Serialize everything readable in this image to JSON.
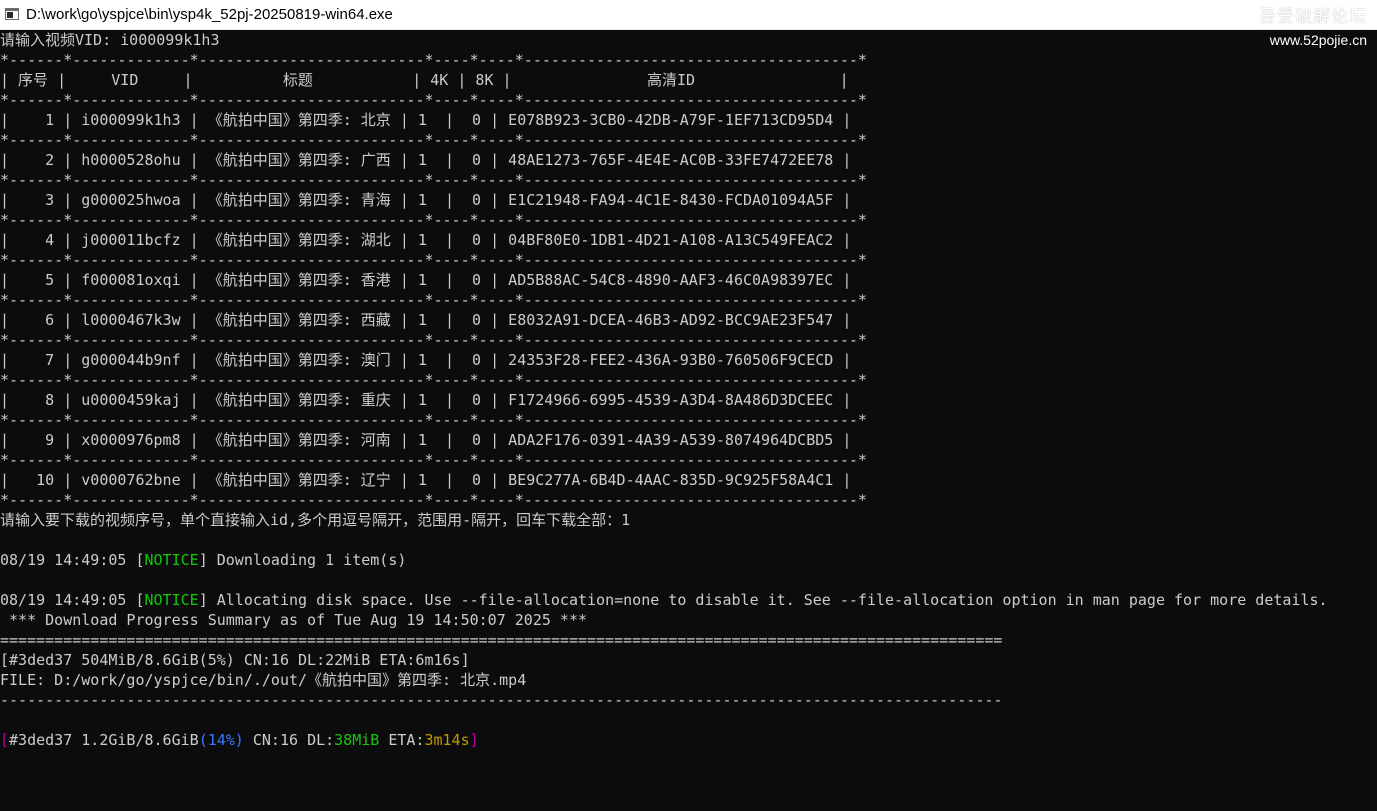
{
  "window": {
    "title": "D:\\work\\go\\yspjce\\bin\\ysp4k_52pj-20250819-win64.exe",
    "watermark_cn": "吾爱破解论坛",
    "watermark_url": "www.52pojie.cn"
  },
  "prompt_vid": "请输入视频VID: i000099k1h3",
  "table": {
    "border_top": "*------*-------------*-------------------------*----*----*-------------------------------------*",
    "headers": [
      "序号",
      "VID",
      "标题",
      "4K",
      "8K",
      "高清ID"
    ],
    "rows": [
      {
        "no": "1",
        "vid": "i000099k1h3",
        "title": "《航拍中国》第四季: 北京",
        "k4": "1",
        "k8": "0",
        "hdid": "E078B923-3CB0-42DB-A79F-1EF713CD95D4"
      },
      {
        "no": "2",
        "vid": "h0000528ohu",
        "title": "《航拍中国》第四季: 广西",
        "k4": "1",
        "k8": "0",
        "hdid": "48AE1273-765F-4E4E-AC0B-33FE7472EE78"
      },
      {
        "no": "3",
        "vid": "g000025hwoa",
        "title": "《航拍中国》第四季: 青海",
        "k4": "1",
        "k8": "0",
        "hdid": "E1C21948-FA94-4C1E-8430-FCDA01094A5F"
      },
      {
        "no": "4",
        "vid": "j000011bcfz",
        "title": "《航拍中国》第四季: 湖北",
        "k4": "1",
        "k8": "0",
        "hdid": "04BF80E0-1DB1-4D21-A108-A13C549FEAC2"
      },
      {
        "no": "5",
        "vid": "f000081oxqi",
        "title": "《航拍中国》第四季: 香港",
        "k4": "1",
        "k8": "0",
        "hdid": "AD5B88AC-54C8-4890-AAF3-46C0A98397EC"
      },
      {
        "no": "6",
        "vid": "l0000467k3w",
        "title": "《航拍中国》第四季: 西藏",
        "k4": "1",
        "k8": "0",
        "hdid": "E8032A91-DCEA-46B3-AD92-BCC9AE23F547"
      },
      {
        "no": "7",
        "vid": "g000044b9nf",
        "title": "《航拍中国》第四季: 澳门",
        "k4": "1",
        "k8": "0",
        "hdid": "24353F28-FEE2-436A-93B0-760506F9CECD"
      },
      {
        "no": "8",
        "vid": "u0000459kaj",
        "title": "《航拍中国》第四季: 重庆",
        "k4": "1",
        "k8": "0",
        "hdid": "F1724966-6995-4539-A3D4-8A486D3DCEEC"
      },
      {
        "no": "9",
        "vid": "x0000976pm8",
        "title": "《航拍中国》第四季: 河南",
        "k4": "1",
        "k8": "0",
        "hdid": "ADA2F176-0391-4A39-A539-8074964DCBD5"
      },
      {
        "no": "10",
        "vid": "v0000762bne",
        "title": "《航拍中国》第四季: 辽宁",
        "k4": "1",
        "k8": "0",
        "hdid": "BE9C277A-6B4D-4AAC-835D-9C925F58A4C1"
      }
    ]
  },
  "prompt_select": "请输入要下载的视频序号，单个直接输入id,多个用逗号隔开，范围用-隔开，回车下载全部：1",
  "log1": {
    "time": "08/19 14:49:05",
    "level": "NOTICE",
    "message": "Downloading 1 item(s)"
  },
  "log2": {
    "time": "08/19 14:49:05",
    "level": "NOTICE",
    "message": "Allocating disk space. Use --file-allocation=none to disable it. See --file-allocation option in man page for more details."
  },
  "summary_header": " *** Download Progress Summary as of Tue Aug 19 14:50:07 2025 ***",
  "summary_rule": "===============================================================================================================",
  "summary_status": "[#3ded37 504MiB/8.6GiB(5%) CN:16 DL:22MiB ETA:6m16s]",
  "summary_file": "FILE: D:/work/go/yspjce/bin/./out/《航拍中国》第四季: 北京.mp4",
  "summary_dash": "---------------------------------------------------------------------------------------------------------------",
  "progress": {
    "open": "[",
    "gid": "#3ded37",
    "size": "1.2GiB/8.6GiB",
    "percent": "(14%)",
    "cn_label": "CN:16",
    "dl_label": "DL:",
    "dl_value": "38MiB",
    "eta_label": "ETA:",
    "eta_value": "3m14s",
    "close": "]"
  },
  "colors": {
    "background": "#0c0c0c",
    "text": "#cccccc",
    "notice": "#16c60c",
    "bracket": "#b4009e",
    "percent": "#3b78ff",
    "eta": "#c19c00"
  }
}
